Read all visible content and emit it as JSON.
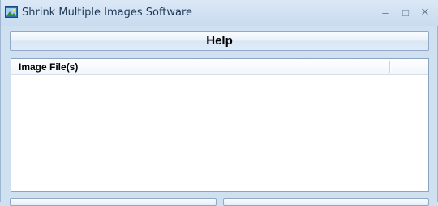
{
  "window": {
    "title": "Shrink Multiple Images Software",
    "icon": "image-app-icon",
    "controls": {
      "minimize": "–",
      "maximize": "□",
      "close": "✕"
    }
  },
  "toolbar": {
    "help_label": "Help"
  },
  "file_list": {
    "columns": [
      "Image File(s)"
    ],
    "rows": []
  },
  "colors": {
    "window_bg": "#cfe0f1",
    "title_text": "#1e3957",
    "border": "#8aa4c1"
  }
}
